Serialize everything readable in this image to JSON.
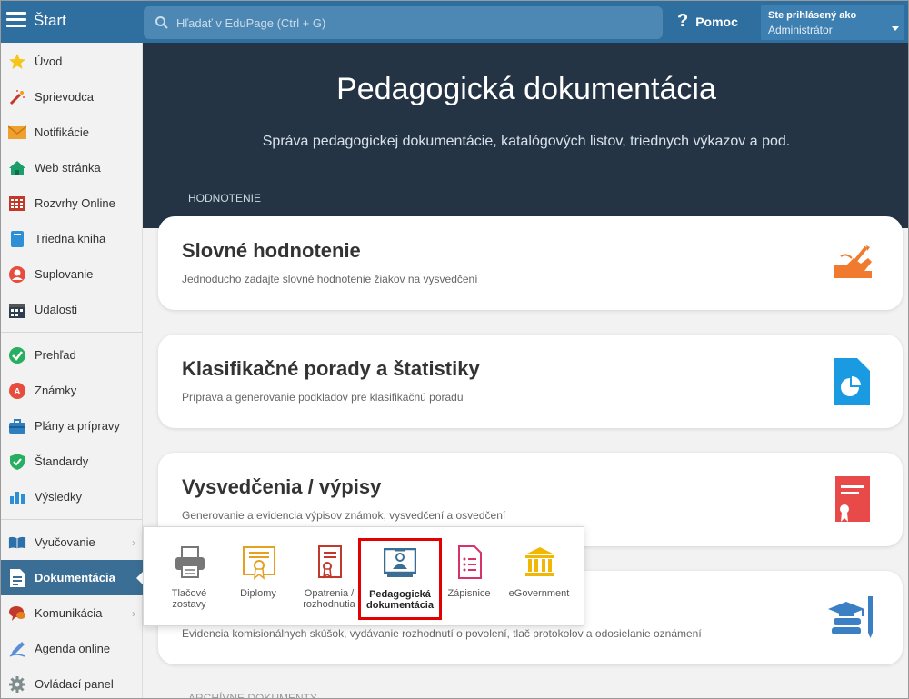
{
  "topbar": {
    "start_label": "Štart",
    "search_placeholder": "Hľadať v EduPage (Ctrl + G)",
    "help_label": "Pomoc",
    "user_line1": "Ste prihlásený ako",
    "user_line2": "Administrátor"
  },
  "sidebar": {
    "items": [
      {
        "label": "Úvod",
        "icon": "star-icon"
      },
      {
        "label": "Sprievodca",
        "icon": "magic-wand-icon"
      },
      {
        "label": "Notifikácie",
        "icon": "envelope-icon"
      },
      {
        "label": "Web stránka",
        "icon": "house-icon"
      },
      {
        "label": "Rozvrhy Online",
        "icon": "timetable-icon"
      },
      {
        "label": "Triedna kniha",
        "icon": "book-icon"
      },
      {
        "label": "Suplovanie",
        "icon": "person-icon"
      },
      {
        "label": "Udalosti",
        "icon": "calendar-icon"
      },
      {
        "label": "Prehľad",
        "icon": "check-circle-icon"
      },
      {
        "label": "Známky",
        "icon": "grade-icon"
      },
      {
        "label": "Plány a prípravy",
        "icon": "briefcase-icon"
      },
      {
        "label": "Štandardy",
        "icon": "shield-check-icon"
      },
      {
        "label": "Výsledky",
        "icon": "bar-chart-icon"
      },
      {
        "label": "Vyučovanie",
        "icon": "open-book-icon"
      },
      {
        "label": "Dokumentácia",
        "icon": "document-icon"
      },
      {
        "label": "Komunikácia",
        "icon": "chat-icon"
      },
      {
        "label": "Agenda online",
        "icon": "pen-icon"
      },
      {
        "label": "Ovládací panel",
        "icon": "gear-icon"
      }
    ]
  },
  "hero": {
    "title": "Pedagogická dokumentácia",
    "subtitle": "Správa pedagogickej dokumentácie, katalógových listov, triednych výkazov a pod.",
    "section": "HODNOTENIE"
  },
  "cards": [
    {
      "title": "Slovné hodnotenie",
      "desc": "Jednoducho zadajte slovné hodnotenie žiakov na vysvedčení"
    },
    {
      "title": "Klasifikačné porady a štatistiky",
      "desc": "Príprava a generovanie podkladov pre klasifikačnú poradu"
    },
    {
      "title": "Vysvedčenia / výpisy",
      "desc": "Generovanie a evidencia výpisov známok, vysvedčení a osvedčení"
    },
    {
      "title": "",
      "desc": "Evidencia komisionálnych skúšok, vydávanie rozhodnutí o povolení, tlač protokolov a odosielanie oznámení"
    }
  ],
  "cut_heading": "ARCHÍVNE DOKUMENTY",
  "popup": {
    "items": [
      {
        "label": "Tlačové zostavy",
        "icon": "printer-icon"
      },
      {
        "label": "Diplomy",
        "icon": "diploma-icon"
      },
      {
        "label": "Opatrenia / rozhodnutia",
        "icon": "decision-document-icon"
      },
      {
        "label": "Pedagogická dokumentácia",
        "icon": "teacher-board-icon"
      },
      {
        "label": "Zápisnice",
        "icon": "minutes-document-icon"
      },
      {
        "label": "eGovernment",
        "icon": "government-building-icon"
      }
    ]
  },
  "colors": {
    "topbar": "#2f6f9f",
    "hero": "#243444",
    "active_sidebar": "#3b6e95",
    "highlight": "#e30000"
  }
}
